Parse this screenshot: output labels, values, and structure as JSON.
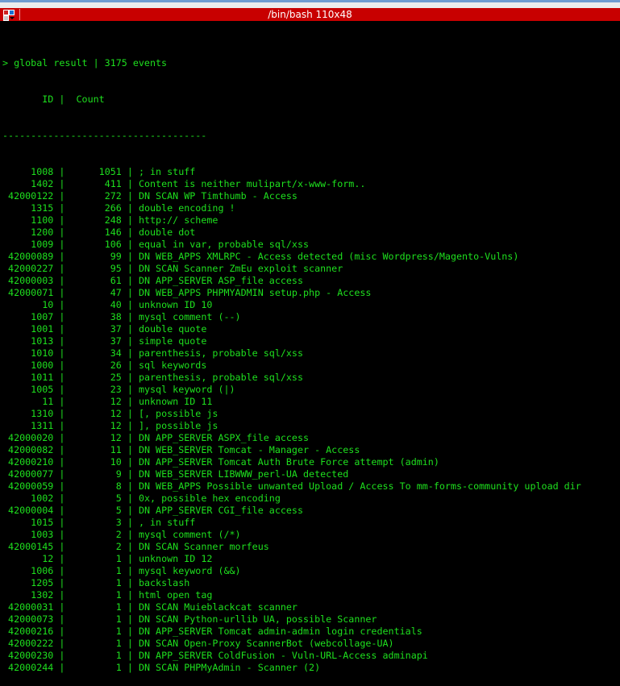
{
  "window": {
    "title": "/bin/bash 110x48"
  },
  "colors": {
    "text": "#1ee01e",
    "titlebar": "#c80000",
    "background": "#000000"
  },
  "terminal": {
    "prompt_line": "> global result | 3175 events",
    "header": {
      "id": "ID",
      "count": "Count",
      "separator": "|"
    },
    "rule": "------------------------------------",
    "rows": [
      [
        "1008",
        "1051",
        "; in stuff"
      ],
      [
        "1402",
        "411",
        "Content is neither mulipart/x-www-form.."
      ],
      [
        "42000122",
        "272",
        "DN SCAN WP Timthumb - Access"
      ],
      [
        "1315",
        "266",
        "double encoding !"
      ],
      [
        "1100",
        "248",
        "http:// scheme"
      ],
      [
        "1200",
        "146",
        "double dot"
      ],
      [
        "1009",
        "106",
        "equal in var, probable sql/xss"
      ],
      [
        "42000089",
        "99",
        "DN WEB_APPS XMLRPC - Access detected (misc Wordpress/Magento-Vulns)"
      ],
      [
        "42000227",
        "95",
        "DN SCAN Scanner ZmEu exploit scanner"
      ],
      [
        "42000003",
        "61",
        "DN APP_SERVER ASP_file access"
      ],
      [
        "42000071",
        "47",
        "DN WEB_APPS PHPMYADMIN setup.php - Access"
      ],
      [
        "10",
        "40",
        "unknown ID 10"
      ],
      [
        "1007",
        "38",
        "mysql comment (--)"
      ],
      [
        "1001",
        "37",
        "double quote"
      ],
      [
        "1013",
        "37",
        "simple quote"
      ],
      [
        "1010",
        "34",
        "parenthesis, probable sql/xss"
      ],
      [
        "1000",
        "26",
        "sql keywords"
      ],
      [
        "1011",
        "25",
        "parenthesis, probable sql/xss"
      ],
      [
        "1005",
        "23",
        "mysql keyword (|)"
      ],
      [
        "11",
        "12",
        "unknown ID 11"
      ],
      [
        "1310",
        "12",
        "[, possible js"
      ],
      [
        "1311",
        "12",
        "], possible js"
      ],
      [
        "42000020",
        "12",
        "DN APP_SERVER ASPX_file access"
      ],
      [
        "42000082",
        "11",
        "DN WEB_SERVER Tomcat - Manager - Access"
      ],
      [
        "42000210",
        "10",
        "DN APP_SERVER Tomcat Auth Brute Force attempt (admin)"
      ],
      [
        "42000077",
        "9",
        "DN WEB_SERVER LIBWWW_perl-UA detected"
      ],
      [
        "42000059",
        "8",
        "DN WEB_APPS Possible unwanted Upload / Access To mm-forms-community upload dir"
      ],
      [
        "1002",
        "5",
        "0x, possible hex encoding"
      ],
      [
        "42000004",
        "5",
        "DN APP_SERVER CGI_file access"
      ],
      [
        "1015",
        "3",
        ", in stuff"
      ],
      [
        "1003",
        "2",
        "mysql comment (/*)"
      ],
      [
        "42000145",
        "2",
        "DN SCAN Scanner morfeus"
      ],
      [
        "12",
        "1",
        "unknown ID 12"
      ],
      [
        "1006",
        "1",
        "mysql keyword (&&)"
      ],
      [
        "1205",
        "1",
        "backslash"
      ],
      [
        "1302",
        "1",
        "html open tag"
      ],
      [
        "42000031",
        "1",
        "DN SCAN Muieblackcat scanner"
      ],
      [
        "42000073",
        "1",
        "DN SCAN Python-urllib UA, possible Scanner"
      ],
      [
        "42000216",
        "1",
        "DN APP_SERVER Tomcat admin-admin login credentials"
      ],
      [
        "42000222",
        "1",
        "DN SCAN Open-Proxy ScannerBot (webcollage-UA)"
      ],
      [
        "42000230",
        "1",
        "DN APP_SERVER ColdFusion - Vuln-URL-Access adminapi"
      ],
      [
        "42000244",
        "1",
        "DN SCAN PHPMyAdmin - Scanner (2)"
      ]
    ]
  }
}
